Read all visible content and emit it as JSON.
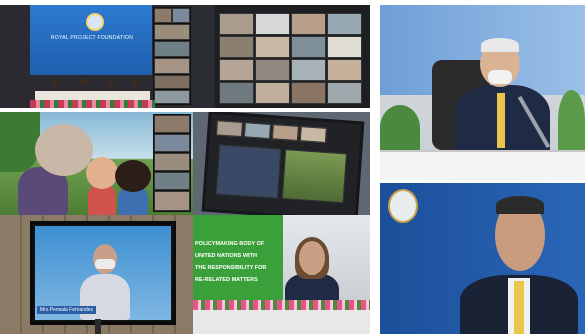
{
  "collage": {
    "panel1": {
      "backdrop_text": "ROYAL PROJECT FOUNDATION"
    },
    "panel7": {
      "caption_name": "Mrs Pensala Fernandez"
    },
    "panel8": {
      "banner_lines": [
        "POLICYMAKING BODY OF",
        "UNITED NATIONS WITH",
        "THE RESPONSIBILITY FOR",
        "RE-RELATED MATTERS"
      ]
    }
  },
  "colors": {
    "zoom_dark": "#1d1f22",
    "stage_blue": "#1f5fae",
    "fao_green": "#3aa13a",
    "room_grey": "#c9ced2",
    "suit_navy": "#1f2a44",
    "tie_yellow": "#e7c64b"
  }
}
